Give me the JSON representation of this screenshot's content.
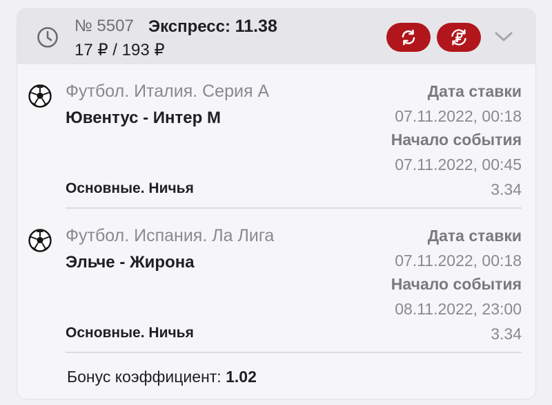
{
  "header": {
    "bet_number": "№ 5507",
    "bet_type_label": "Экспресс:",
    "bet_type_coef": "11.38",
    "amounts": "17 ₽ / 193 ₽"
  },
  "events": [
    {
      "league": "Футбол. Италия. Серия А",
      "match": "Ювентус - Интер М",
      "market": "Основные. Ничья",
      "bet_date_label": "Дата ставки",
      "bet_date": "07.11.2022, 00:18",
      "event_start_label": "Начало события",
      "event_start": "07.11.2022, 00:45",
      "odds": "3.34",
      "icon": "soccer-ball-icon"
    },
    {
      "league": "Футбол. Испания. Ла Лига",
      "match": "Эльче - Жирона",
      "market": "Основные. Ничья",
      "bet_date_label": "Дата ставки",
      "bet_date": "07.11.2022, 00:18",
      "event_start_label": "Начало события",
      "event_start": "08.11.2022, 23:00",
      "odds": "3.34",
      "icon": "soccer-ball-icon"
    }
  ],
  "bonus": {
    "label": "Бонус коэффициент:",
    "value": "1.02"
  },
  "colors": {
    "accent": "#b0161c",
    "header_bg": "#e6e6ea",
    "card_bg": "#f6f6f8"
  }
}
